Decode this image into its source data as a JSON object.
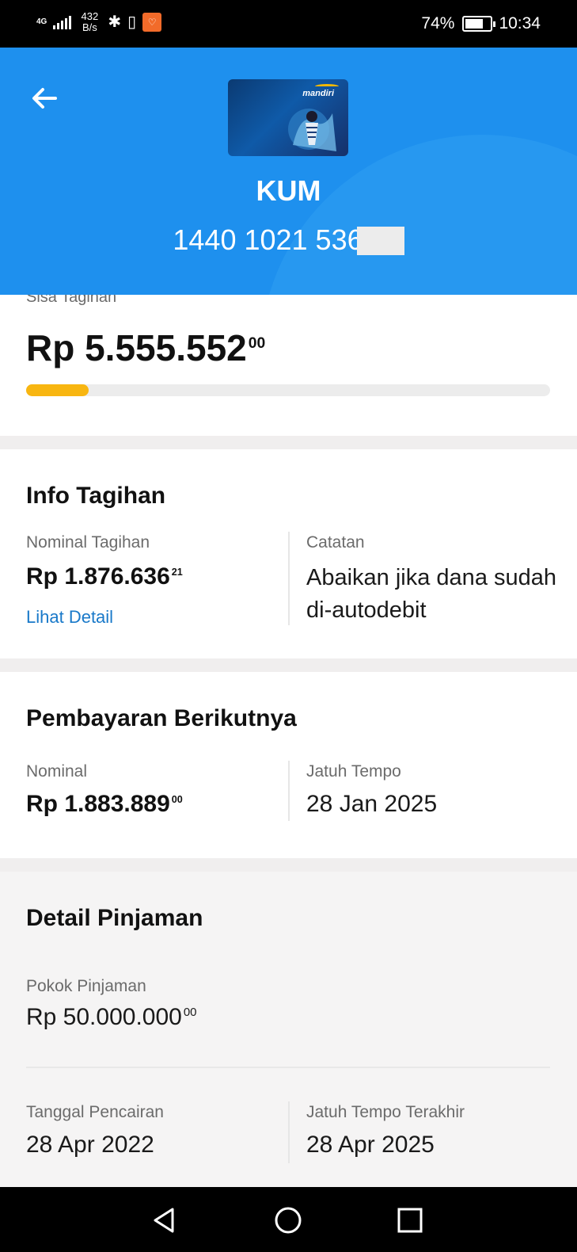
{
  "status_bar": {
    "network": "4G",
    "speed_value": "432",
    "speed_unit": "B/s",
    "battery": "74%",
    "time": "10:34",
    "battery_level": 0.74
  },
  "header": {
    "card_brand": "mandiri",
    "account_name": "KUM",
    "account_number": "1440 1021 536"
  },
  "balance": {
    "label": "Sisa Tagihan",
    "amount": "Rp 5.555.552",
    "cents": "00",
    "progress": 0.12
  },
  "info_tagihan": {
    "title": "Info Tagihan",
    "nominal_label": "Nominal Tagihan",
    "nominal_amount": "Rp 1.876.636",
    "nominal_cents": "21",
    "detail_link": "Lihat Detail",
    "note_label": "Catatan",
    "note_text": "Abaikan jika dana sudah di-autodebit"
  },
  "next_payment": {
    "title": "Pembayaran Berikutnya",
    "nominal_label": "Nominal",
    "nominal_amount": "Rp 1.883.889",
    "nominal_cents": "00",
    "due_label": "Jatuh Tempo",
    "due_date": "28 Jan 2025"
  },
  "loan_detail": {
    "title": "Detail Pinjaman",
    "principal_label": "Pokok Pinjaman",
    "principal_amount": "Rp 50.000.000",
    "principal_cents": "00",
    "disbursement_label": "Tanggal Pencairan",
    "disbursement_date": "28 Apr 2022",
    "final_due_label": "Jatuh Tempo Terakhir",
    "final_due_date": "28 Apr 2025"
  },
  "colors": {
    "header_blue": "#1e90ee",
    "progress_yellow": "#f8b611",
    "link_blue": "#1979c9"
  },
  "icons": {
    "back": "arrow-left-icon",
    "nav_back": "triangle-back-icon",
    "nav_home": "circle-home-icon",
    "nav_recent": "square-recent-icon"
  }
}
